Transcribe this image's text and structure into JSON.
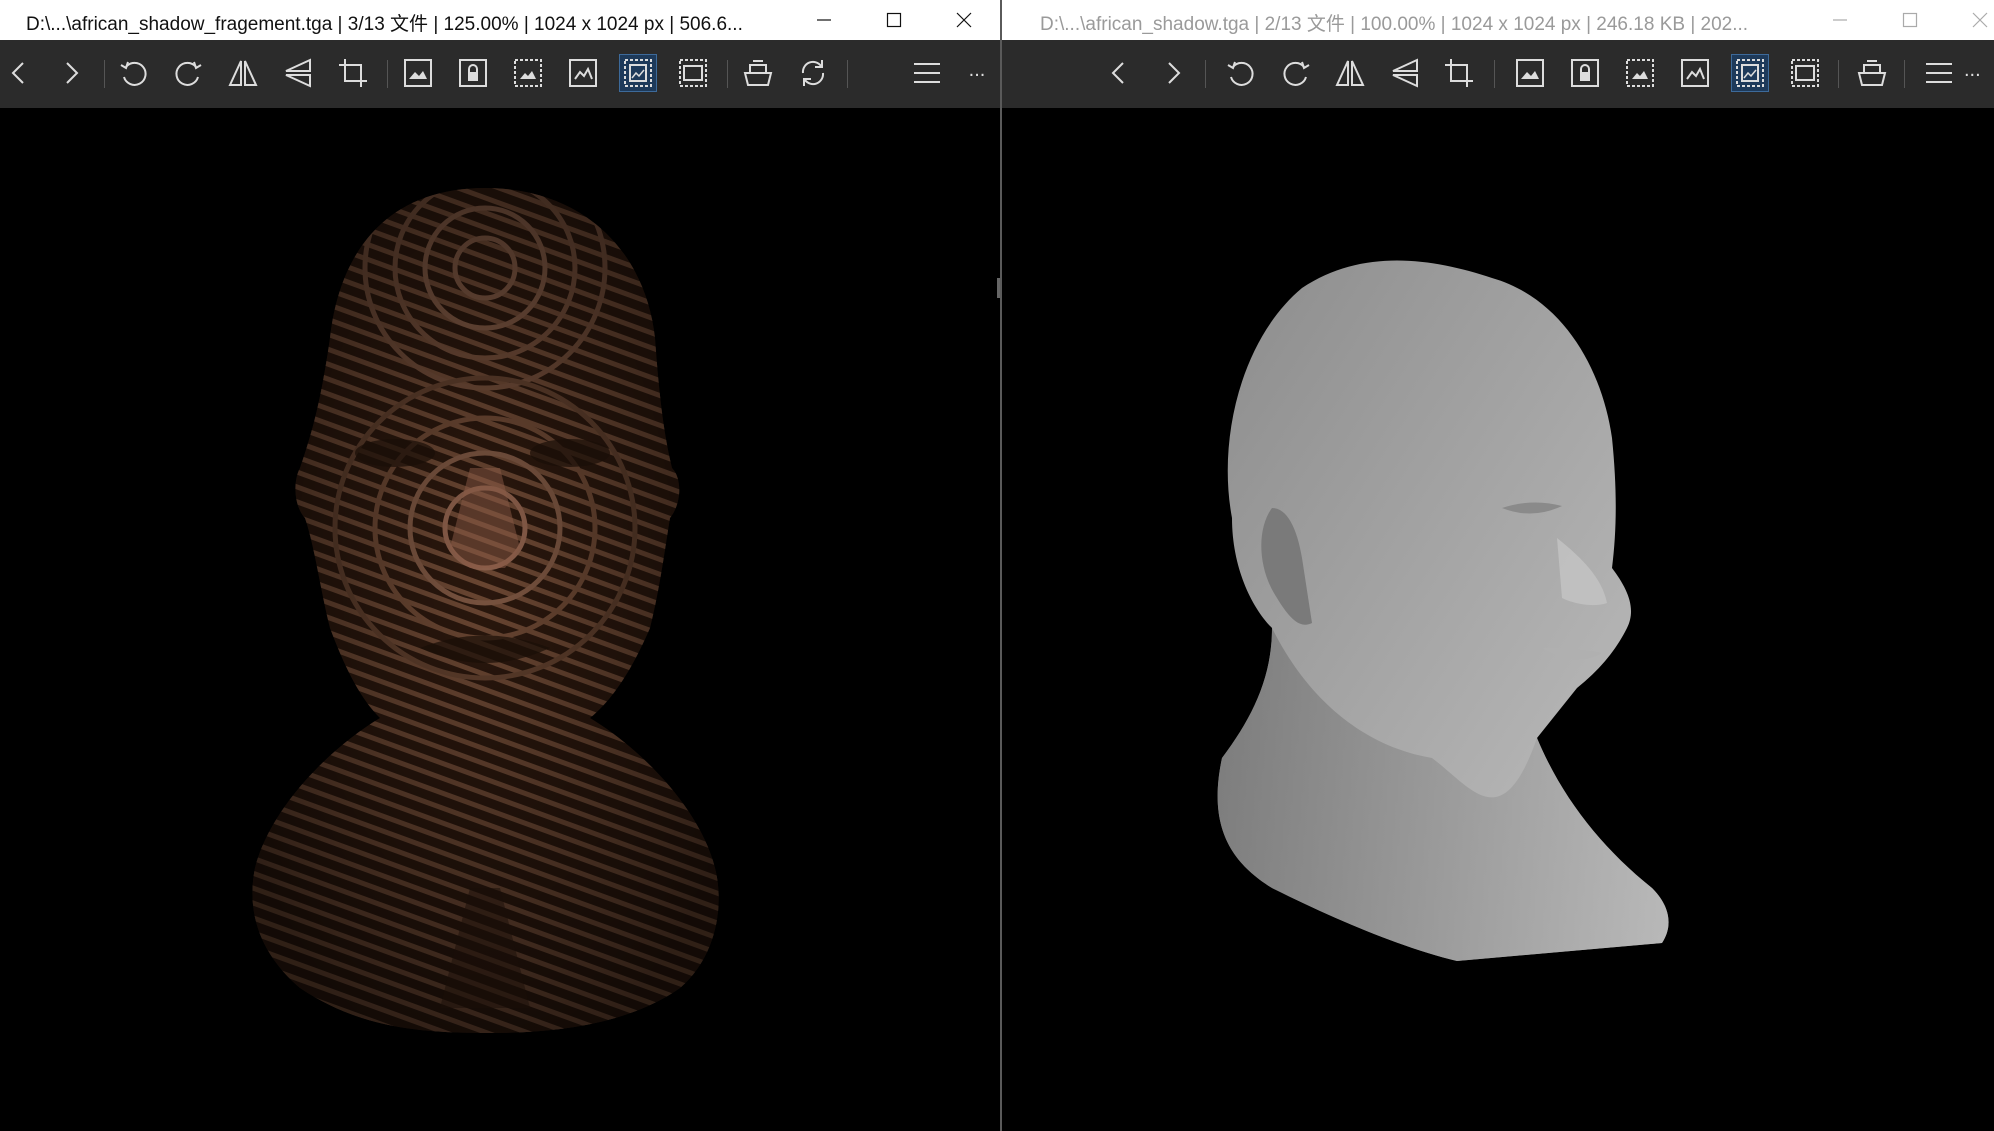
{
  "left_window": {
    "title": "D:\\...\\african_shadow_fragement.tga  |  3/13 文件  |  125.00%  |  1024 x 1024 px  |  506.6...",
    "active": true
  },
  "right_window": {
    "title": "D:\\...\\african_shadow.tga  |  2/13 文件  |  100.00%  |  1024 x 1024 px  |  246.18 KB  |  202...",
    "active": false
  },
  "toolbar_icons": [
    "chevron-left-icon",
    "chevron-right-icon",
    "rotate-left-icon",
    "rotate-right-icon",
    "flip-horizontal-icon",
    "flip-vertical-icon",
    "crop-icon",
    "fit-image-icon",
    "lock-zoom-icon",
    "actual-size-icon",
    "fit-width-icon",
    "fit-window-icon",
    "fill-window-icon",
    "print-icon",
    "refresh-icon",
    "menu-icon",
    "more-icon"
  ],
  "more_label": "...",
  "colors": {
    "toolbar_bg": "#2b2b2b",
    "active_icon_bg": "#1e3a5a",
    "viewport_bg": "#000000"
  }
}
